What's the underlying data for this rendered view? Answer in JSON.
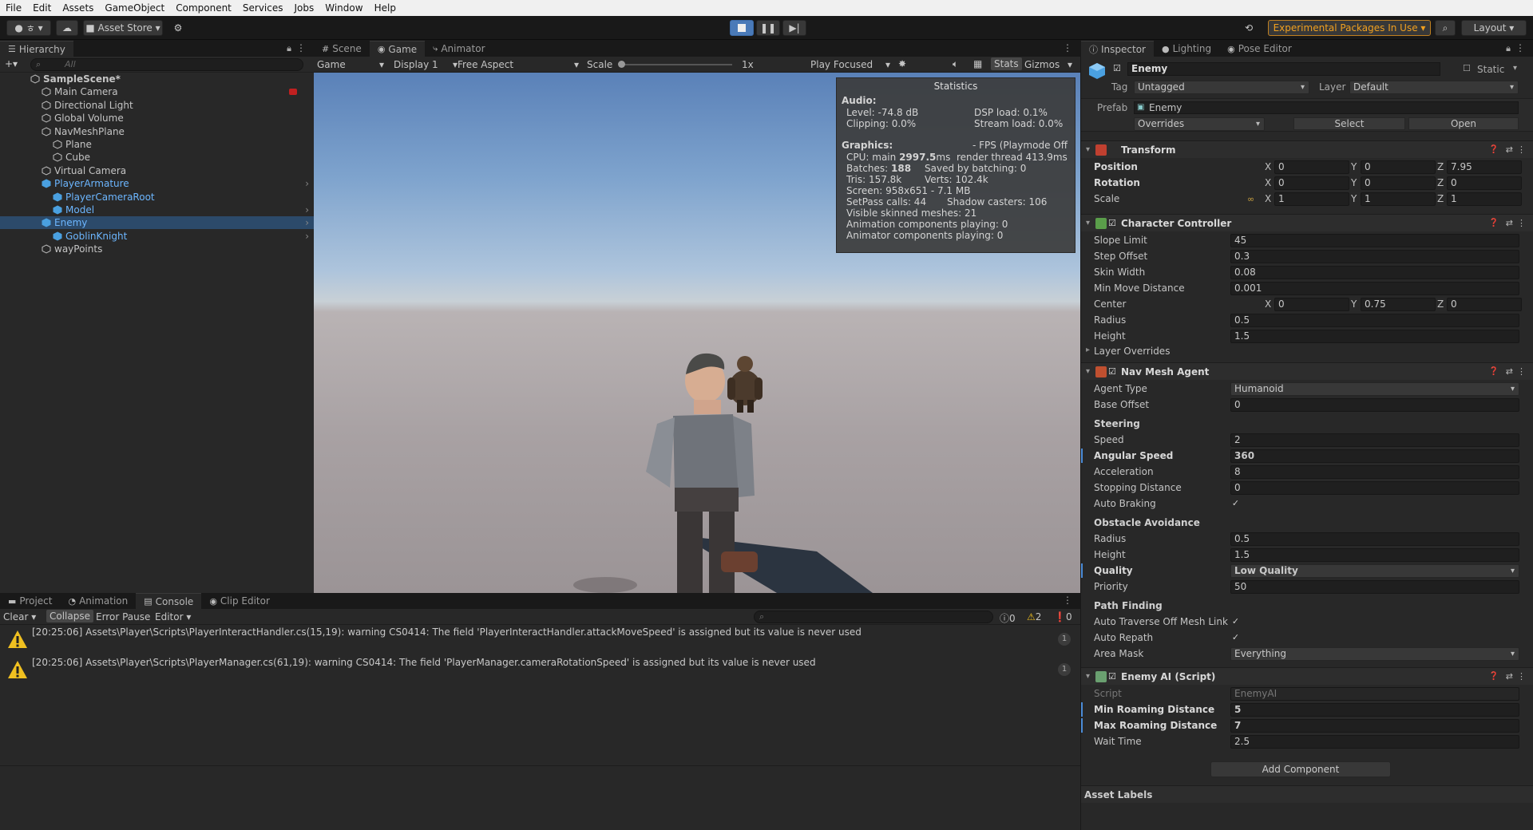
{
  "menu": [
    "File",
    "Edit",
    "Assets",
    "GameObject",
    "Component",
    "Services",
    "Jobs",
    "Window",
    "Help"
  ],
  "toolbar": {
    "account_label": "ㅎ",
    "asset_store": "Asset Store",
    "experimental": "Experimental Packages In Use",
    "layout": "Layout"
  },
  "hierarchy": {
    "tab": "Hierarchy",
    "search_placeholder": "All",
    "items": [
      {
        "label": "SampleScene*",
        "indent": 0,
        "bold": true
      },
      {
        "label": "Main Camera",
        "indent": 1
      },
      {
        "label": "Directional Light",
        "indent": 1
      },
      {
        "label": "Global Volume",
        "indent": 1
      },
      {
        "label": "NavMeshPlane",
        "indent": 1
      },
      {
        "label": "Plane",
        "indent": 2
      },
      {
        "label": "Cube",
        "indent": 2
      },
      {
        "label": "Virtual Camera",
        "indent": 1
      },
      {
        "label": "PlayerArmature",
        "indent": 1,
        "blue": true
      },
      {
        "label": "PlayerCameraRoot",
        "indent": 2,
        "blue": true
      },
      {
        "label": "Model",
        "indent": 2,
        "blue": true
      },
      {
        "label": "Enemy",
        "indent": 1,
        "blue": true,
        "selected": true
      },
      {
        "label": "GoblinKnight",
        "indent": 2,
        "blue": true
      },
      {
        "label": "wayPoints",
        "indent": 1
      }
    ]
  },
  "view": {
    "tabs": [
      "Scene",
      "Game",
      "Animator"
    ],
    "game_dropdown": "Game",
    "display": "Display 1",
    "aspect": "Free Aspect",
    "scale_label": "Scale",
    "scale_value": "1x",
    "play_mode": "Play Focused",
    "stats_btn": "Stats",
    "gizmos_btn": "Gizmos"
  },
  "stats": {
    "title": "Statistics",
    "audio_h": "Audio:",
    "level": "Level: -74.8 dB",
    "clipping": "Clipping: 0.0%",
    "dsp": "DSP load: 0.1%",
    "stream": "Stream load: 0.0%",
    "graphics_h": "Graphics:",
    "fps": "- FPS (Playmode Off",
    "cpu_pre": "CPU: main ",
    "cpu_val": "2997.5",
    "cpu_post": "ms  render thread 413.9ms",
    "batches_pre": "Batches: ",
    "batches_val": "188",
    "batching": "Saved by batching: 0",
    "tris": "Tris: 157.8k",
    "verts": "Verts: 102.4k",
    "screen": "Screen: 958x651 - 7.1 MB",
    "setpass": "SetPass calls: 44",
    "shadow": "Shadow casters: 106",
    "skinned": "Visible skinned meshes: 21",
    "anim": "Animation components playing: 0",
    "animator": "Animator components playing: 0"
  },
  "bottom": {
    "tabs": [
      "Project",
      "Animation",
      "Console",
      "Clip Editor"
    ],
    "clear": "Clear",
    "collapse": "Collapse",
    "error_pause": "Error Pause",
    "editor": "Editor",
    "count_info": "0",
    "count_warn": "2",
    "count_err": "0",
    "logs": [
      {
        "text": "[20:25:06] Assets\\Player\\Scripts\\PlayerInteractHandler.cs(15,19): warning CS0414: The field 'PlayerInteractHandler.attackMoveSpeed' is assigned but its value is never used",
        "count": "1"
      },
      {
        "text": "[20:25:06] Assets\\Player\\Scripts\\PlayerManager.cs(61,19): warning CS0414: The field 'PlayerManager.cameraRotationSpeed' is assigned but its value is never used",
        "count": "1"
      }
    ]
  },
  "inspector": {
    "tabs": [
      "Inspector",
      "Lighting",
      "Pose Editor"
    ],
    "name": "Enemy",
    "static": "Static",
    "tag_label": "Tag",
    "tag": "Untagged",
    "layer_label": "Layer",
    "layer": "Default",
    "prefab_label": "Prefab",
    "prefab": "Enemy",
    "overrides": "Overrides",
    "select": "Select",
    "open": "Open",
    "transform": {
      "title": "Transform",
      "rows": [
        {
          "label": "Position",
          "x": "0",
          "y": "0",
          "z": "7.95"
        },
        {
          "label": "Rotation",
          "x": "0",
          "y": "0",
          "z": "0"
        },
        {
          "label": "Scale",
          "x": "1",
          "y": "1",
          "z": "1"
        }
      ]
    },
    "cc": {
      "title": "Character Controller",
      "rows": [
        {
          "label": "Slope Limit",
          "value": "45"
        },
        {
          "label": "Step Offset",
          "value": "0.3"
        },
        {
          "label": "Skin Width",
          "value": "0.08"
        },
        {
          "label": "Min Move Distance",
          "value": "0.001"
        }
      ],
      "center_label": "Center",
      "center_x": "0",
      "center_y": "0.75",
      "center_z": "0",
      "radius_label": "Radius",
      "radius": "0.5",
      "height_label": "Height",
      "height": "1.5",
      "layer_overrides": "Layer Overrides"
    },
    "nav": {
      "title": "Nav Mesh Agent",
      "agent_type_label": "Agent Type",
      "agent_type": "Humanoid",
      "base_offset_label": "Base Offset",
      "base_offset": "0",
      "steering": "Steering",
      "speed_label": "Speed",
      "speed": "2",
      "angular_label": "Angular Speed",
      "angular": "360",
      "accel_label": "Acceleration",
      "accel": "8",
      "stop_label": "Stopping Distance",
      "stop": "0",
      "braking_label": "Auto Braking",
      "obstacle": "Obstacle Avoidance",
      "radius_label": "Radius",
      "radius": "0.5",
      "height_label": "Height",
      "height": "1.5",
      "quality_label": "Quality",
      "quality": "Low Quality",
      "priority_label": "Priority",
      "priority": "50",
      "pathfinding": "Path Finding",
      "traverse_label": "Auto Traverse Off Mesh Link",
      "repath_label": "Auto Repath",
      "area_label": "Area Mask",
      "area": "Everything"
    },
    "ai": {
      "title": "Enemy AI (Script)",
      "script_label": "Script",
      "script": "EnemyAI",
      "min_label": "Min Roaming Distance",
      "min": "5",
      "max_label": "Max Roaming Distance",
      "max": "7",
      "wait_label": "Wait Time",
      "wait": "2.5"
    },
    "add_component": "Add Component",
    "asset_labels": "Asset Labels"
  }
}
